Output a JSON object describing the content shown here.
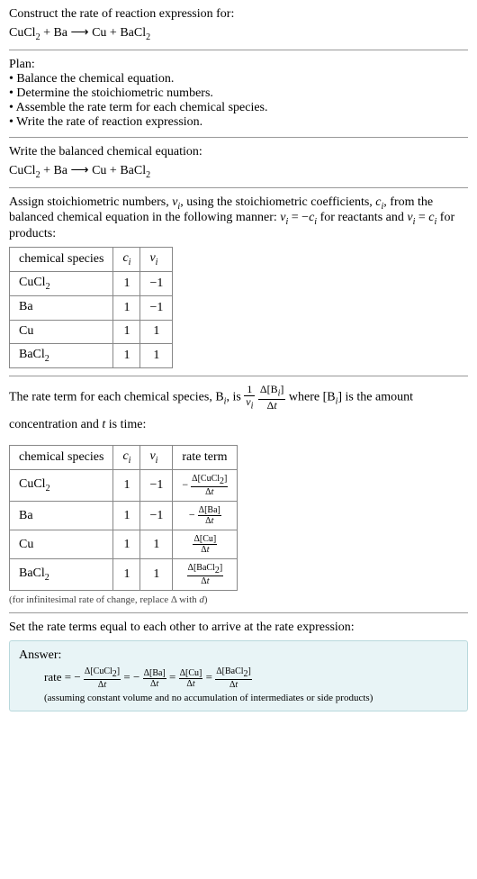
{
  "header": {
    "prompt": "Construct the rate of reaction expression for:",
    "equation_lhs1": "CuCl",
    "equation_lhs1_sub": "2",
    "equation_plus1": " + Ba  ⟶  Cu + BaCl",
    "equation_rhs_sub": "2"
  },
  "plan": {
    "title": "Plan:",
    "items": [
      "• Balance the chemical equation.",
      "• Determine the stoichiometric numbers.",
      "• Assemble the rate term for each chemical species.",
      "• Write the rate of reaction expression."
    ]
  },
  "balanced": {
    "title": "Write the balanced chemical equation:",
    "eq_a": "CuCl",
    "eq_a_sub": "2",
    "eq_mid": " + Ba  ⟶  Cu + BaCl",
    "eq_b_sub": "2"
  },
  "stoich": {
    "intro_a": "Assign stoichiometric numbers, ",
    "nu": "ν",
    "i": "i",
    "intro_b": ", using the stoichiometric coefficients, ",
    "c": "c",
    "intro_c": ", from the balanced chemical equation in the following manner: ",
    "rel1_a": "ν",
    "rel1_b": " = −",
    "rel1_c": "c",
    "intro_d": " for reactants and ",
    "rel2_a": "ν",
    "rel2_b": " = ",
    "rel2_c": "c",
    "intro_e": " for products:",
    "headers": {
      "species": "chemical species",
      "ci": "c",
      "ci_sub": "i",
      "vi": "ν",
      "vi_sub": "i"
    },
    "rows": [
      {
        "sp_a": "CuCl",
        "sp_sub": "2",
        "c": "1",
        "v": "−1"
      },
      {
        "sp_a": "Ba",
        "sp_sub": "",
        "c": "1",
        "v": "−1"
      },
      {
        "sp_a": "Cu",
        "sp_sub": "",
        "c": "1",
        "v": "1"
      },
      {
        "sp_a": "BaCl",
        "sp_sub": "2",
        "c": "1",
        "v": "1"
      }
    ]
  },
  "rateterm": {
    "intro_a": "The rate term for each chemical species, B",
    "intro_b": ", is ",
    "frac1_num": "1",
    "frac1_den_a": "ν",
    "frac1_den_sub": "i",
    "frac2_num_a": "Δ[B",
    "frac2_num_b": "]",
    "frac2_den": "Δt",
    "intro_c": " where [B",
    "intro_d": "] is the amount concentration and ",
    "t": "t",
    "intro_e": " is time:",
    "headers": {
      "species": "chemical species",
      "ci": "c",
      "ci_sub": "i",
      "vi": "ν",
      "vi_sub": "i",
      "rate": "rate term"
    },
    "rows": [
      {
        "sp_a": "CuCl",
        "sp_sub": "2",
        "c": "1",
        "v": "−1",
        "neg": "−",
        "num_a": "Δ[CuCl",
        "num_sub": "2",
        "num_b": "]",
        "den": "Δt"
      },
      {
        "sp_a": "Ba",
        "sp_sub": "",
        "c": "1",
        "v": "−1",
        "neg": "−",
        "num_a": "Δ[Ba]",
        "num_sub": "",
        "num_b": "",
        "den": "Δt"
      },
      {
        "sp_a": "Cu",
        "sp_sub": "",
        "c": "1",
        "v": "1",
        "neg": "",
        "num_a": "Δ[Cu]",
        "num_sub": "",
        "num_b": "",
        "den": "Δt"
      },
      {
        "sp_a": "BaCl",
        "sp_sub": "2",
        "c": "1",
        "v": "1",
        "neg": "",
        "num_a": "Δ[BaCl",
        "num_sub": "2",
        "num_b": "]",
        "den": "Δt"
      }
    ],
    "caption_a": "(for infinitesimal rate of change, replace Δ with ",
    "caption_d": "d",
    "caption_b": ")"
  },
  "final": {
    "title": "Set the rate terms equal to each other to arrive at the rate expression:"
  },
  "answer": {
    "label": "Answer:",
    "rate_word": "rate = −",
    "t1_num_a": "Δ[CuCl",
    "t1_num_sub": "2",
    "t1_num_b": "]",
    "t1_den": "Δt",
    "eq1": " = −",
    "t2_num": "Δ[Ba]",
    "t2_den": "Δt",
    "eq2": " = ",
    "t3_num": "Δ[Cu]",
    "t3_den": "Δt",
    "eq3": " = ",
    "t4_num_a": "Δ[BaCl",
    "t4_num_sub": "2",
    "t4_num_b": "]",
    "t4_den": "Δt",
    "note": "(assuming constant volume and no accumulation of intermediates or side products)"
  }
}
